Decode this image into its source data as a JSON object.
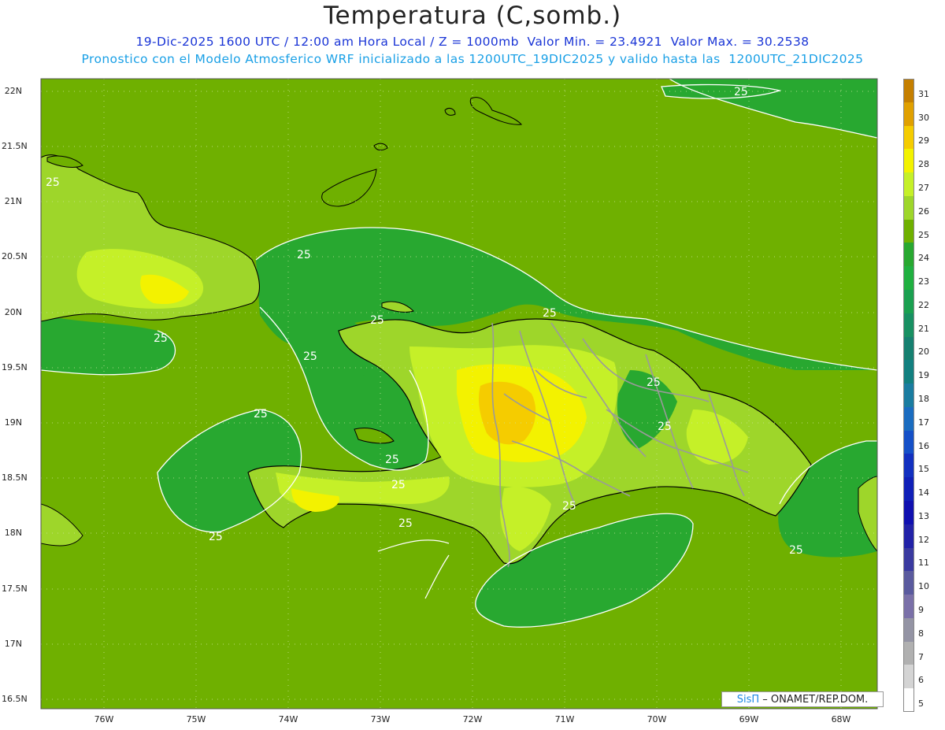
{
  "header": {
    "title": "Temperatura (C,somb.)",
    "subtitle1": "19-Dic-2025 1600 UTC / 12:00 am Hora Local / Z = 1000mb  Valor Min. = 23.4921  Valor Max. = 30.2538",
    "subtitle2": "Pronostico con el Modelo Atmosferico WRF inicializado a las 1200UTC_19DIC2025 y valido hasta las  1200UTC_21DIC2025"
  },
  "axes": {
    "lat_labels": [
      "22N",
      "21.5N",
      "21N",
      "20.5N",
      "20N",
      "19.5N",
      "19N",
      "18.5N",
      "18N",
      "17.5N",
      "17N",
      "16.5N"
    ],
    "lon_labels": [
      "76W",
      "75W",
      "74W",
      "73W",
      "72W",
      "71W",
      "70W",
      "69W",
      "68W"
    ]
  },
  "contour_labels": [
    "25",
    "25",
    "25",
    "25",
    "25",
    "25",
    "25",
    "25",
    "25",
    "25",
    "25",
    "25",
    "25",
    "25",
    "25",
    "25"
  ],
  "colorbar": {
    "labels": [
      "31",
      "30",
      "29",
      "28",
      "27",
      "26",
      "25",
      "24",
      "23",
      "22",
      "21",
      "20",
      "19",
      "18",
      "17",
      "16",
      "15",
      "14",
      "13",
      "12",
      "11",
      "10",
      "9",
      "8",
      "7",
      "6",
      "5"
    ],
    "colors": [
      "#c57f00",
      "#e0a000",
      "#f5cc00",
      "#f3f200",
      "#c5f028",
      "#9ed62a",
      "#6fb000",
      "#28a830",
      "#20b040",
      "#1aa050",
      "#189062",
      "#168070",
      "#128080",
      "#1a7ca0",
      "#1a6cc0",
      "#1550c8",
      "#1230c0",
      "#1020b8",
      "#1010b0",
      "#2222a8",
      "#3a3aa0",
      "#5a5a9e",
      "#7a70a8",
      "#9494a4",
      "#b0b0b0",
      "#d4d4d4",
      "#ffffff"
    ]
  },
  "palette": {
    "sea": "#6fb000",
    "land_low": "#9ed62a",
    "land_mid": "#c5f028",
    "land_high": "#f3f200",
    "land_peak": "#f5cc00",
    "cool": "#28a830",
    "coast": "#000000",
    "border": "#999999",
    "contour": "#ffffff"
  },
  "credit": {
    "brand": "SisΠ",
    "text": "– ONAMET/REP.DOM."
  }
}
